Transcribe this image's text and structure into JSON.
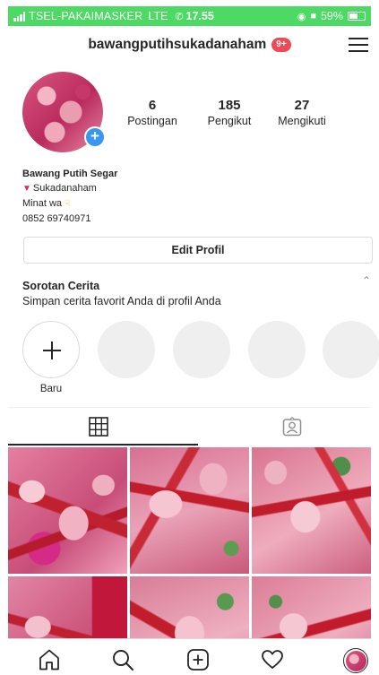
{
  "status_bar": {
    "carrier": "TSEL-PAKAIMASKER",
    "network": "LTE",
    "time": "17.55",
    "battery": "59%",
    "battery_level": 0.59,
    "color": "#4cd964"
  },
  "header": {
    "username": "bawangputihsukadanaham",
    "notification_badge": "9+",
    "badge_color": "#ed4956"
  },
  "profile": {
    "stats": [
      {
        "value": "6",
        "label": "Postingan"
      },
      {
        "value": "185",
        "label": "Pengikut"
      },
      {
        "value": "27",
        "label": "Mengikuti"
      }
    ],
    "bio": {
      "name": "Bawang Putih Segar",
      "location": "Sukadanaham",
      "line3": "Minat wa",
      "phone": "0852 69740971"
    },
    "edit_button": "Edit Profil",
    "accent_color": "#3897f0"
  },
  "highlights": {
    "title": "Sorotan Cerita",
    "subtitle": "Simpan cerita favorit Anda di profil Anda",
    "new_label": "Baru"
  },
  "tabs": [
    {
      "icon": "grid-icon",
      "selected": true
    },
    {
      "icon": "tagged-person-icon",
      "selected": false
    }
  ],
  "grid": {
    "photos": [
      "garlic-sacks-photo",
      "garlic-sacks-photo",
      "garlic-sacks-photo",
      "garlic-sacks-photo",
      "garlic-sacks-photo",
      "garlic-sacks-photo"
    ]
  },
  "bottom_nav": {
    "items": [
      "home-icon",
      "search-icon",
      "new-post-icon",
      "activity-heart-icon",
      "profile-avatar"
    ]
  }
}
